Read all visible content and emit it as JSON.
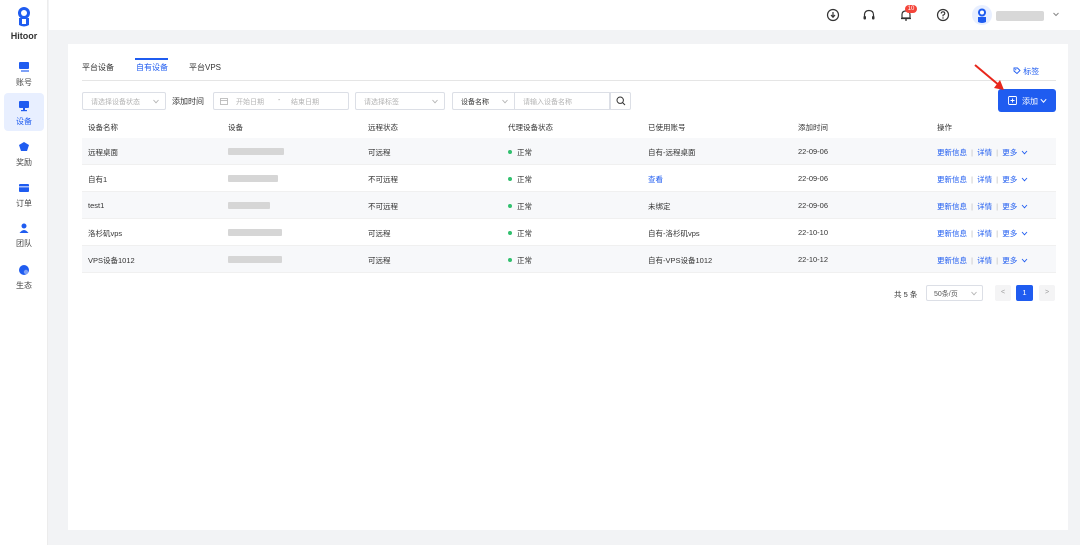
{
  "app": {
    "name": "Hitoor"
  },
  "sidebar": {
    "items": [
      {
        "label": "账号",
        "icon": "account-icon"
      },
      {
        "label": "设备",
        "icon": "device-icon",
        "active": true
      },
      {
        "label": "奖励",
        "icon": "reward-icon"
      },
      {
        "label": "订单",
        "icon": "order-icon"
      },
      {
        "label": "团队",
        "icon": "team-icon"
      },
      {
        "label": "生态",
        "icon": "ecosystem-icon"
      }
    ]
  },
  "header": {
    "notification_count": "10"
  },
  "tabs": [
    {
      "label": "平台设备"
    },
    {
      "label": "自有设备",
      "active": true
    },
    {
      "label": "平台VPS"
    }
  ],
  "tag_link": "标签",
  "filters": {
    "status_placeholder": "请选择设备状态",
    "add_time_label": "添加时间",
    "start_date": "开始日期",
    "date_sep": "-",
    "end_date": "结束日期",
    "tag_placeholder": "请选择标签",
    "search_key": "设备名称",
    "search_placeholder": "请输入设备名称"
  },
  "add_button": "添加",
  "table": {
    "columns": [
      "设备名称",
      "设备",
      "远程状态",
      "代理设备状态",
      "已使用账号",
      "添加时间",
      "操作"
    ],
    "rows": [
      {
        "name": "远程桌面",
        "remote": "可远程",
        "proxy": "正常",
        "account": "自有-远程桌面",
        "account_link": false,
        "date": "22-09-06"
      },
      {
        "name": "自有1",
        "remote": "不可远程",
        "proxy": "正常",
        "account": "查看",
        "account_link": true,
        "date": "22-09-06"
      },
      {
        "name": "test1",
        "remote": "不可远程",
        "proxy": "正常",
        "account": "未绑定",
        "account_link": false,
        "date": "22-09-06"
      },
      {
        "name": "洛杉矶vps",
        "remote": "可远程",
        "proxy": "正常",
        "account": "自有-洛杉矶vps",
        "account_link": false,
        "date": "22-10-10"
      },
      {
        "name": "VPS设备1012",
        "remote": "可远程",
        "proxy": "正常",
        "account": "自有-VPS设备1012",
        "account_link": false,
        "date": "22-10-12"
      }
    ],
    "ops": {
      "update": "更新信息",
      "detail": "详情",
      "more": "更多"
    }
  },
  "pagination": {
    "total": "共 5 条",
    "page_size": "50条/页",
    "current_page": "1",
    "prev": "<",
    "next": ">"
  },
  "colors": {
    "accent": "#1f5cf0",
    "status_ok": "#31c06e",
    "annotation": "#e8271c"
  }
}
